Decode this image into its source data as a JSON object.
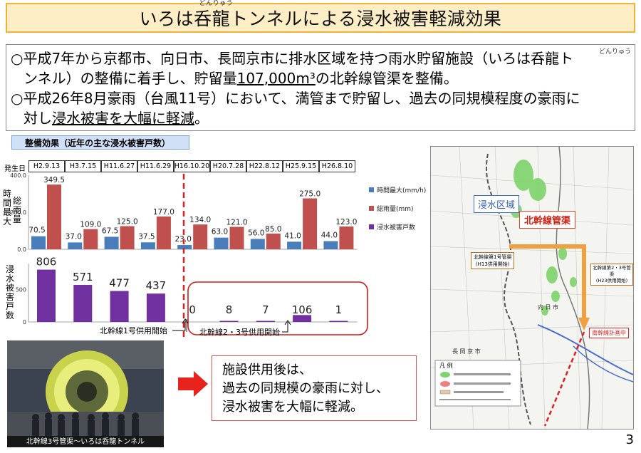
{
  "title": {
    "text": "いろは呑龍トンネルによる浸水被害軽減効果",
    "ruby": "どんりゅう"
  },
  "summary": {
    "line1": "○平成7年から京都市、向日市、長岡京市に排水区域を持つ雨水貯留施設（いろは呑龍ト",
    "line1_ruby": "どんりゅう",
    "line2_a": "ンネル）の整備に着手し、貯留量",
    "line2_ul": "107,000m³",
    "line2_b": "の北幹線管渠を整備。",
    "line3": "○平成26年8月豪雨（台風11号）において、満管まで貯留し、過去の同規模程度の豪雨に",
    "line4_a": "対し",
    "line4_ul": "浸水被害を大幅に軽減",
    "line4_b": "。"
  },
  "section_label": "整備効果（近年の主な浸水被害戸数）",
  "date_row_label": "発生日",
  "chart_labels": {
    "upper_ylabel_a": "時間最大",
    "upper_ylabel_b": "総雨量",
    "lower_ylabel": "浸水被害戸数",
    "upper_ticks": [
      "400.0",
      "200.0",
      "0.0"
    ],
    "lower_ticks": [
      "500",
      "0"
    ]
  },
  "chart_data": {
    "type": "bar",
    "categories": [
      "H2.9.13",
      "H3.7.15",
      "H11.6.27",
      "H11.6.29",
      "H16.10.20",
      "H20.7.28",
      "H22.8.12",
      "H25.9.15",
      "H26.8.10"
    ],
    "series": [
      {
        "name": "時間最大(mm/h)",
        "color": "#4a7ebb",
        "values": [
          70.5,
          37.0,
          67.5,
          37.5,
          23.0,
          63.0,
          56.0,
          41.0,
          44.0
        ],
        "labels": [
          "70.5",
          "37.0",
          "67.5",
          "37.5",
          "23.0",
          "63.0",
          "56.0",
          "41.0",
          "44.0"
        ]
      },
      {
        "name": "総雨量(mm)",
        "color": "#c0504d",
        "values": [
          349.5,
          109.0,
          125.0,
          177.0,
          134.0,
          121.0,
          85.0,
          275.0,
          123.0
        ],
        "labels": [
          "349.5",
          "109.0",
          "125.0",
          "177.0",
          "134.0",
          "121.0",
          "85.0",
          "275.0",
          "123.0"
        ]
      },
      {
        "name": "浸水被害戸数",
        "color": "#7030a0",
        "values": [
          806,
          571,
          477,
          437,
          0,
          8,
          7,
          106,
          1
        ],
        "labels": [
          "806",
          "571",
          "477",
          "437",
          "0",
          "8",
          "7",
          "106",
          "1"
        ]
      }
    ],
    "ylim_upper": [
      0,
      400
    ],
    "ylim_lower": [
      0,
      900
    ],
    "legend_position": "right"
  },
  "annotations": {
    "open1": "北幹線1号供用開始",
    "open23": "北幹線2・3号供用開始"
  },
  "callout": {
    "line1": "施設供用後は、",
    "line2": "過去の同規模の豪雨に対し、",
    "line3": "浸水被害を大幅に軽減。"
  },
  "photo_caption": "北幹線3号管渠～いろは呑龍トンネル",
  "map": {
    "flood_area": "浸水区域",
    "trunk": "北幹線管渠",
    "no1": "北幹線第1号管渠",
    "no1_sub": "(H13供用開始)",
    "no23": "北幹線第2・3号管渠",
    "no23_sub": "(H23供用開始)",
    "plan": "南幹線計画中",
    "legend_title": "凡 例",
    "city1": "長 岡 京 市",
    "city2": "向 日 市"
  },
  "page_number": "3"
}
